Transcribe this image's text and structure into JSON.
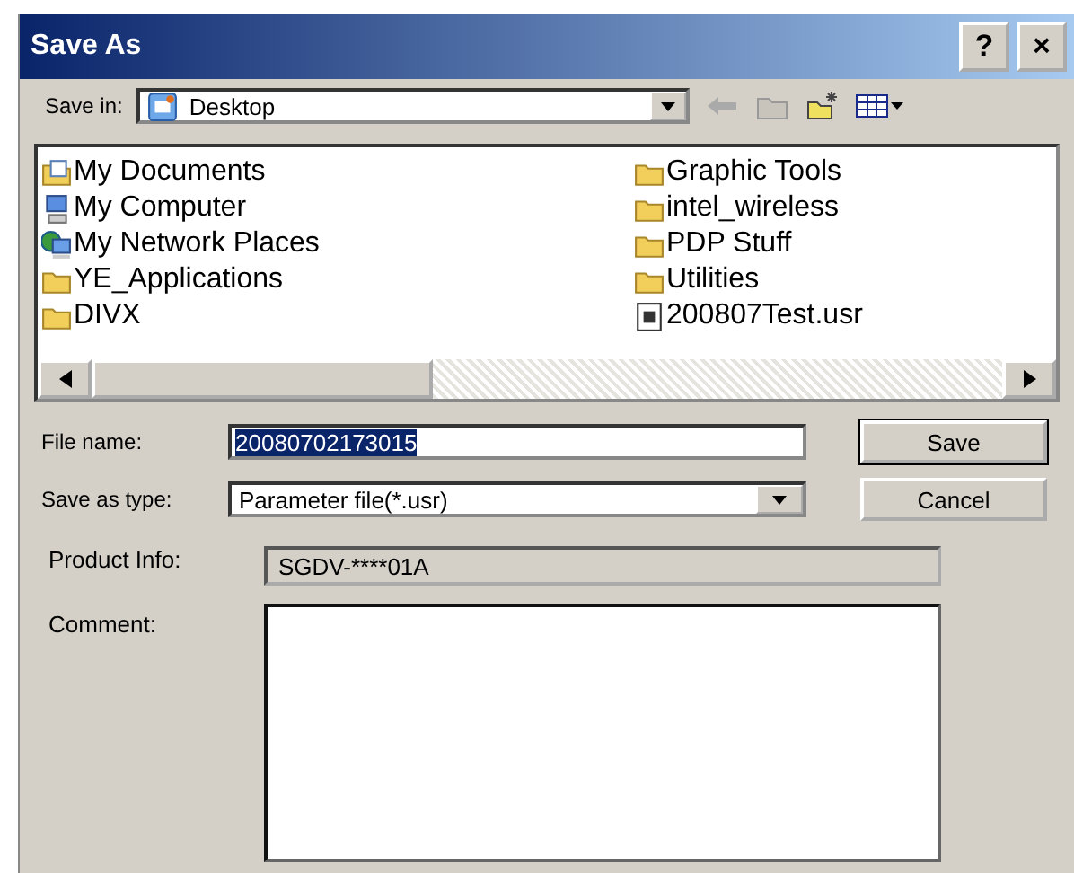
{
  "window": {
    "title": "Save As",
    "buttons": [
      "?",
      "×"
    ]
  },
  "save_in": {
    "label": "Save in:",
    "value": "Desktop"
  },
  "files": [
    {
      "name": "My Documents",
      "kind": "documents"
    },
    {
      "name": "My Computer",
      "kind": "computer"
    },
    {
      "name": "My Network Places",
      "kind": "network"
    },
    {
      "name": "YE_Applications",
      "kind": "folder"
    },
    {
      "name": "DIVX",
      "kind": "folder"
    },
    {
      "name": "Graphic Tools",
      "kind": "folder"
    },
    {
      "name": "intel_wireless",
      "kind": "folder"
    },
    {
      "name": "PDP Stuff",
      "kind": "folder"
    },
    {
      "name": "Utilities",
      "kind": "folder"
    },
    {
      "name": "200807Test.usr",
      "kind": "file"
    }
  ],
  "file_name": {
    "label": "File name:",
    "value": "20080702173015",
    "text_selected": true
  },
  "save_as_type": {
    "label": "Save as type:",
    "value": "Parameter file(*.usr)"
  },
  "buttons": [
    {
      "label": "Save",
      "default": true
    },
    {
      "label": "Cancel",
      "default": false
    }
  ],
  "product_info": {
    "label": "Product Info:",
    "value": "SGDV-****01A"
  },
  "comment": {
    "label": "Comment:"
  }
}
